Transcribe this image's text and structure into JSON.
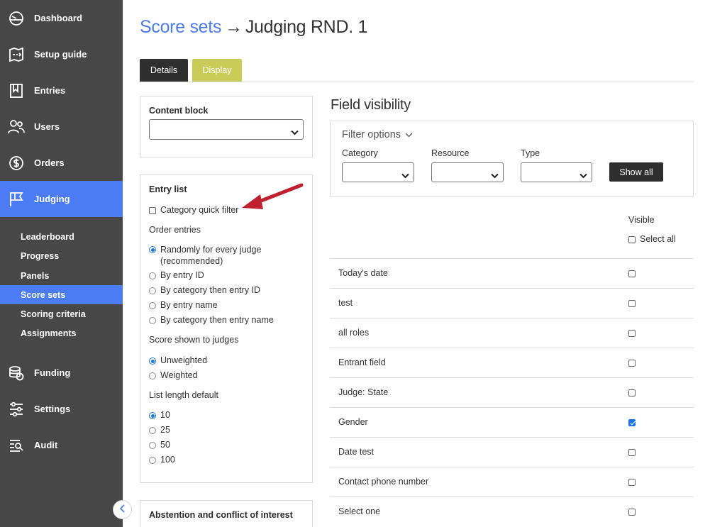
{
  "sidebar": {
    "nav": [
      {
        "label": "Dashboard",
        "icon": "dashboard-icon"
      },
      {
        "label": "Setup guide",
        "icon": "setup-guide-icon"
      },
      {
        "label": "Entries",
        "icon": "entries-icon"
      },
      {
        "label": "Users",
        "icon": "users-icon"
      },
      {
        "label": "Orders",
        "icon": "orders-icon"
      },
      {
        "label": "Judging",
        "icon": "judging-icon",
        "active": true
      }
    ],
    "sub": [
      {
        "label": "Leaderboard"
      },
      {
        "label": "Progress"
      },
      {
        "label": "Panels"
      },
      {
        "label": "Score sets",
        "active": true
      },
      {
        "label": "Scoring criteria"
      },
      {
        "label": "Assignments"
      }
    ],
    "nav_bottom": [
      {
        "label": "Funding",
        "icon": "funding-icon"
      },
      {
        "label": "Settings",
        "icon": "settings-icon"
      },
      {
        "label": "Audit",
        "icon": "audit-icon"
      }
    ]
  },
  "header": {
    "breadcrumb_link": "Score sets",
    "arrow": "→",
    "page_name": "Judging RND. 1"
  },
  "tabs": {
    "details": "Details",
    "display": "Display"
  },
  "content_block": {
    "title": "Content block",
    "value": ""
  },
  "entry_list": {
    "title": "Entry list",
    "quick_filter": {
      "label": "Category quick filter",
      "checked": false
    },
    "order_label": "Order entries",
    "order_options": [
      {
        "label": "Randomly for every judge",
        "label2": "(recommended)",
        "selected": true
      },
      {
        "label": "By entry ID",
        "selected": false
      },
      {
        "label": "By category then entry ID",
        "selected": false
      },
      {
        "label": "By entry name",
        "selected": false
      },
      {
        "label": "By category then entry name",
        "selected": false
      }
    ],
    "score_label": "Score shown to judges",
    "score_options": [
      {
        "label": "Unweighted",
        "selected": true
      },
      {
        "label": "Weighted",
        "selected": false
      }
    ],
    "length_label": "List length default",
    "length_options": [
      {
        "label": "10",
        "selected": true
      },
      {
        "label": "25",
        "selected": false
      },
      {
        "label": "50",
        "selected": false
      },
      {
        "label": "100",
        "selected": false
      }
    ]
  },
  "abstention": {
    "title": "Abstention and conflict of interest"
  },
  "field_visibility": {
    "title": "Field visibility",
    "filter_options_label": "Filter options",
    "filters": {
      "category": "Category",
      "resource": "Resource",
      "type": "Type"
    },
    "show_all": "Show all",
    "visible_header": "Visible",
    "select_all": "Select all",
    "rows": [
      {
        "label": "Today's date",
        "visible": false
      },
      {
        "label": "test",
        "visible": false
      },
      {
        "label": "all roles",
        "visible": false
      },
      {
        "label": "Entrant field",
        "visible": false
      },
      {
        "label": "Judge: State",
        "visible": false
      },
      {
        "label": "Gender",
        "visible": true
      },
      {
        "label": "Date test",
        "visible": false
      },
      {
        "label": "Contact phone number",
        "visible": false
      },
      {
        "label": "Select one",
        "visible": false
      }
    ]
  },
  "colors": {
    "accent": "#4b7bf5",
    "sidebar": "#474747",
    "display_tab": "#c9cd57",
    "annotation": "#c0202e"
  }
}
